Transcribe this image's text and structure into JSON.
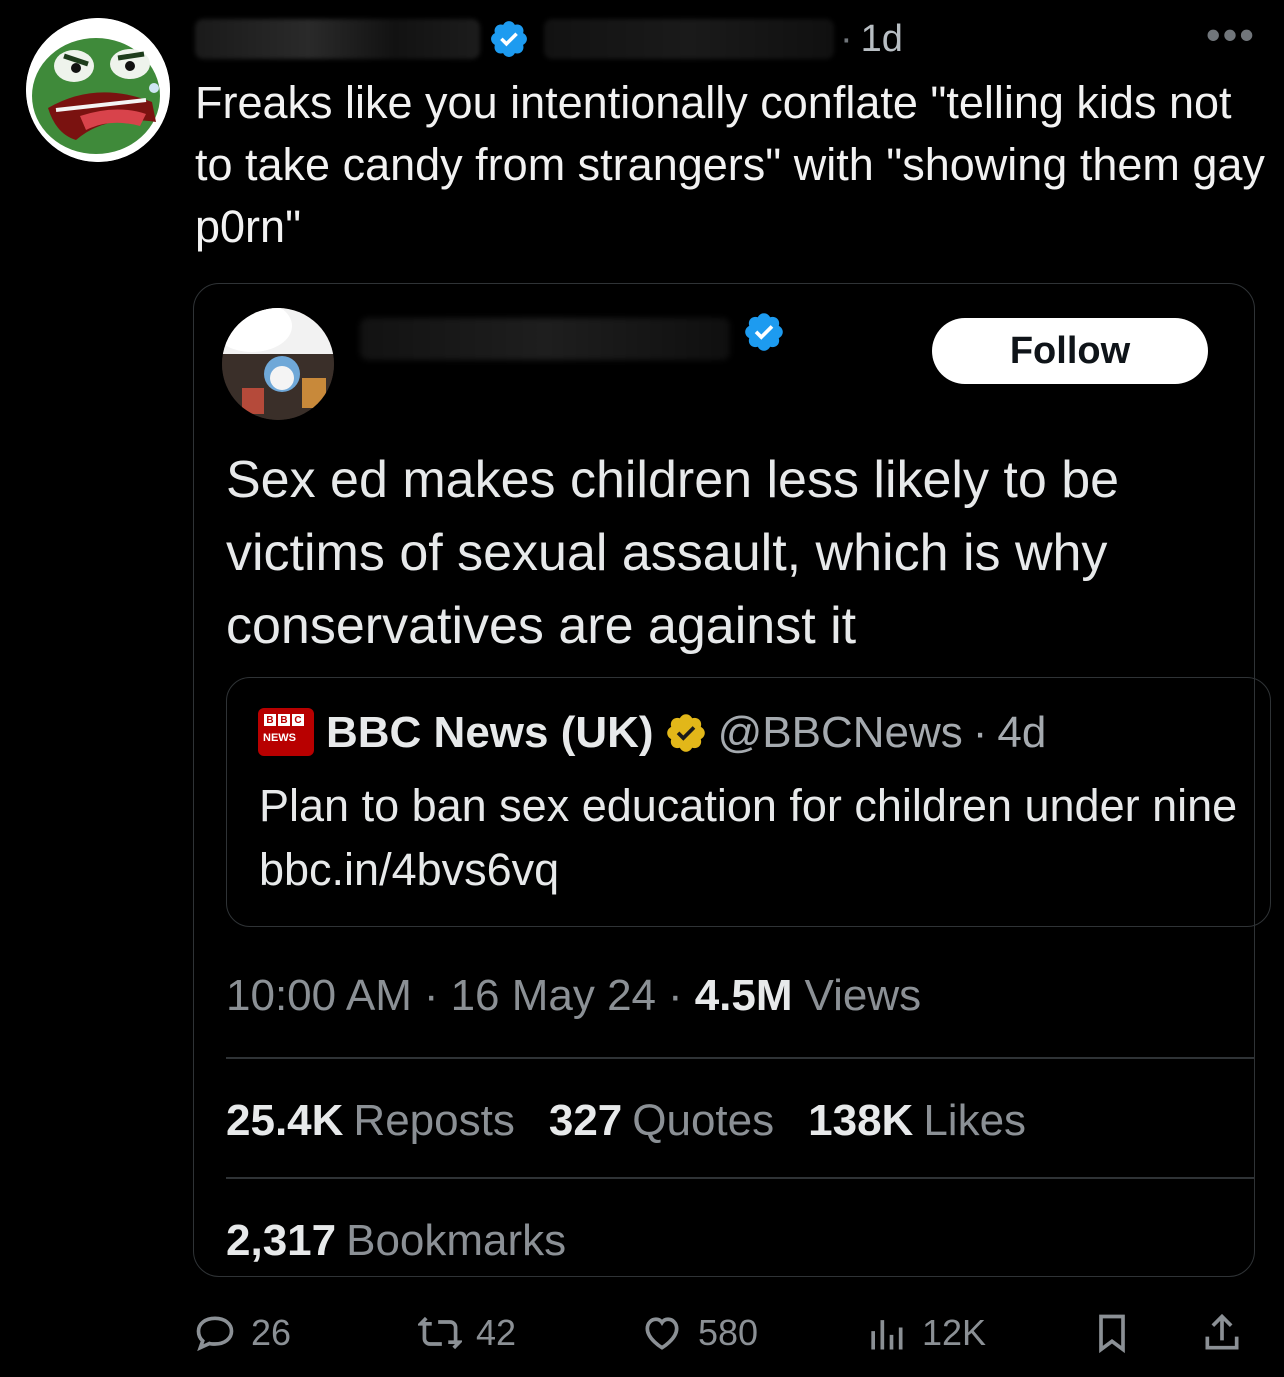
{
  "tweet": {
    "time": "1d",
    "more_label": "•••",
    "text": "Freaks like you intentionally conflate \"telling kids not to take candy from strangers\" with \"showing them gay p0rn\""
  },
  "quoted": {
    "follow_label": "Follow",
    "text": "Sex ed makes children less likely to be victims of sexual assault, which is why conservatives are against it",
    "inner": {
      "logo_text": "BBC",
      "logo_sub": "NEWS",
      "name": "BBC News (UK)",
      "handle": "@BBCNews",
      "sep": "·",
      "time": "4d",
      "text": "Plan to ban sex education for children under nine bbc.in/4bvs6vq"
    },
    "meta": {
      "time": "10:00 AM",
      "date": "16 May 24",
      "sep": "·",
      "views_count": "4.5M",
      "views_label": "Views"
    },
    "stats": [
      {
        "count": "25.4K",
        "label": "Reposts"
      },
      {
        "count": "327",
        "label": "Quotes"
      },
      {
        "count": "138K",
        "label": "Likes"
      }
    ],
    "bookmarks": {
      "count": "2,317",
      "label": "Bookmarks"
    }
  },
  "actions": {
    "replies": "26",
    "reposts": "42",
    "likes": "580",
    "views": "12K"
  },
  "colors": {
    "background": "#000000",
    "verified_blue": "#1d9bf0",
    "verified_gold": "#e2b719",
    "bbc_red": "#b80000",
    "muted_text": "#8b9095"
  },
  "icons": [
    "verified-badge-icon",
    "more-icon",
    "gold-verified-badge-icon",
    "reply-icon",
    "repost-icon",
    "like-icon",
    "views-icon",
    "bookmark-icon",
    "share-icon"
  ]
}
